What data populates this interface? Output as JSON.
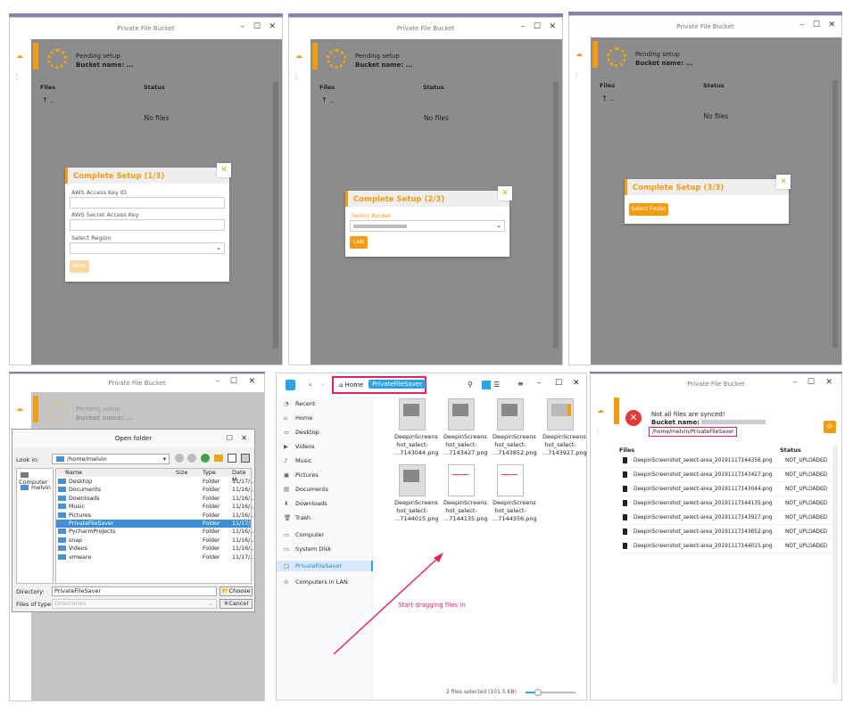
{
  "app_title": "Private File Bucket",
  "pending": {
    "status": "Pending setup",
    "bucket_label": "Bucket name: ..."
  },
  "table": {
    "files_header": "Files",
    "status_header": "Status",
    "parent": "..",
    "empty": "No files"
  },
  "step1": {
    "title": "Complete Setup (1/3)",
    "access_key_label": "AWS Access Key ID",
    "secret_key_label": "AWS Secret Access Key",
    "region_label": "Select Region",
    "next_label": "Next"
  },
  "step2": {
    "title": "Complete Setup (2/3)",
    "bucket_label": "Select Bucket",
    "last_label": "Last"
  },
  "step3": {
    "title": "Complete Setup (3/3)",
    "select_folder_label": "Select Folder"
  },
  "open_folder": {
    "title": "Open folder",
    "look_in_label": "Look in:",
    "look_in_value": "/home/melvin",
    "sidebar": [
      "Computer",
      "melvin"
    ],
    "columns": [
      "Name",
      "Size",
      "Type",
      "Date M"
    ],
    "rows": [
      {
        "name": "Desktop",
        "type": "Folder",
        "date": "11/17/.."
      },
      {
        "name": "Documents",
        "type": "Folder",
        "date": "11/16/.."
      },
      {
        "name": "Downloads",
        "type": "Folder",
        "date": "11/16/.."
      },
      {
        "name": "Music",
        "type": "Folder",
        "date": "11/16/.."
      },
      {
        "name": "Pictures",
        "type": "Folder",
        "date": "11/16/.."
      },
      {
        "name": "PrivateFileSaver",
        "type": "Folder",
        "date": "11/17/.."
      },
      {
        "name": "PycharmProjects",
        "type": "Folder",
        "date": "11/16/.."
      },
      {
        "name": "snap",
        "type": "Folder",
        "date": "11/16/.."
      },
      {
        "name": "Videos",
        "type": "Folder",
        "date": "11/16/.."
      },
      {
        "name": "vmware",
        "type": "Folder",
        "date": "11/17/.."
      }
    ],
    "directory_label": "Directory:",
    "directory_value": "PrivateFileSaver",
    "filetype_label": "Files of type:",
    "filetype_value": "Directories",
    "choose_label": "Choose",
    "cancel_label": "Cancel"
  },
  "file_manager": {
    "breadcrumb_home": "Home",
    "breadcrumb_current": "PrivateFileSaver",
    "nav": [
      "Recent",
      "Home",
      "Desktop",
      "Videos",
      "Music",
      "Pictures",
      "Documents",
      "Downloads",
      "Trash",
      "Computer",
      "System Disk",
      "PrivateFileSaver",
      "Computers in LAN"
    ],
    "files": [
      {
        "l1": "DeepinScreens",
        "l2": "hot_select-",
        "l3": "...7143044.png"
      },
      {
        "l1": "DeepinScreens",
        "l2": "hot_select-",
        "l3": "...7143427.png"
      },
      {
        "l1": "DeepinScreens",
        "l2": "hot_select-",
        "l3": "...7143852.png"
      },
      {
        "l1": "DeepinScreens",
        "l2": "hot_select-",
        "l3": "...7143927.png"
      },
      {
        "l1": "DeepinScreens",
        "l2": "hot_select-",
        "l3": "...7144015.png"
      },
      {
        "l1": "DeepinScreens",
        "l2": "hot_select-",
        "l3": "...7144135.png"
      },
      {
        "l1": "DeepinScreens",
        "l2": "hot_select-",
        "l3": "...7144356.png"
      }
    ],
    "annotation": "Start dragging files in",
    "status": "2 files selected (101.5 KB)"
  },
  "synced": {
    "message": "Not all files are synced!",
    "bucket_label": "Bucket name:",
    "path": "/home/melvin/PrivateFileSaver",
    "rows": [
      {
        "file": "DeepinScreenshot_select-area_20191117144356.png",
        "status": "NOT_UPLOADED"
      },
      {
        "file": "DeepinScreenshot_select-area_20191117143427.png",
        "status": "NOT_UPLOADED"
      },
      {
        "file": "DeepinScreenshot_select-area_20191117143044.png",
        "status": "NOT_UPLOADED"
      },
      {
        "file": "DeepinScreenshot_select-area_20191117144135.png",
        "status": "NOT_UPLOADED"
      },
      {
        "file": "DeepinScreenshot_select-area_20191117143927.png",
        "status": "NOT_UPLOADED"
      },
      {
        "file": "DeepinScreenshot_select-area_20191117143852.png",
        "status": "NOT_UPLOADED"
      },
      {
        "file": "DeepinScreenshot_select-area_20191117144015.png",
        "status": "NOT_UPLOADED"
      }
    ]
  },
  "colors": {
    "accent": "#f39c12",
    "annotation": "#e91e63",
    "selection": "#3b8fd6"
  }
}
